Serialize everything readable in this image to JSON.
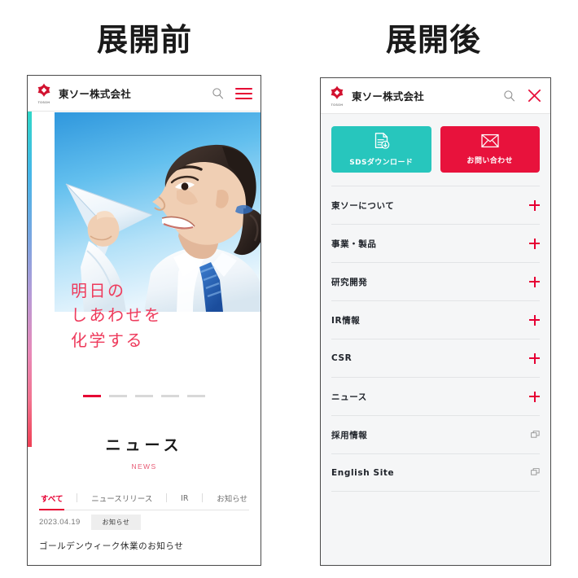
{
  "captions": {
    "before": "展開前",
    "after": "展開後"
  },
  "colors": {
    "brand_red": "#e60033",
    "accent_teal": "#27c6bd",
    "cta_red": "#e8123c",
    "tagline_pink": "#ee3b5c"
  },
  "brand": {
    "logo_text": "東ソー株式会社",
    "logo_sub": "TOSOH"
  },
  "closed_phone": {
    "header": {
      "search_icon": "search-icon",
      "menu_icon": "hamburger-icon"
    },
    "hero": {
      "tagline_lines": [
        "明日の",
        "しあわせを",
        "化学する"
      ],
      "slide_count": 5,
      "active_slide": 1
    },
    "news": {
      "title_ja": "ニュース",
      "title_en": "NEWS",
      "tabs": [
        {
          "label": "すべて",
          "active": true
        },
        {
          "label": "ニュースリリース",
          "active": false
        },
        {
          "label": "IR",
          "active": false
        },
        {
          "label": "お知らせ",
          "active": false
        }
      ],
      "items": [
        {
          "date": "2023.04.19",
          "badge": "お知らせ",
          "title": "ゴールデンウィーク休業のお知らせ"
        }
      ]
    }
  },
  "open_phone": {
    "header": {
      "search_icon": "search-icon",
      "close_icon": "close-icon"
    },
    "cta_buttons": [
      {
        "label": "SDSダウンロード",
        "icon": "document-download-icon",
        "style": "teal"
      },
      {
        "label": "お問い合わせ",
        "icon": "mail-icon",
        "style": "red"
      }
    ],
    "menu_items": [
      {
        "label": "東ソーについて",
        "icon": "plus-icon"
      },
      {
        "label": "事業・製品",
        "icon": "plus-icon"
      },
      {
        "label": "研究開発",
        "icon": "plus-icon"
      },
      {
        "label": "IR情報",
        "icon": "plus-icon"
      },
      {
        "label": "CSR",
        "icon": "plus-icon"
      },
      {
        "label": "ニュース",
        "icon": "plus-icon"
      },
      {
        "label": "採用情報",
        "icon": "external-link-icon"
      },
      {
        "label": "English Site",
        "icon": "external-link-icon"
      }
    ]
  }
}
